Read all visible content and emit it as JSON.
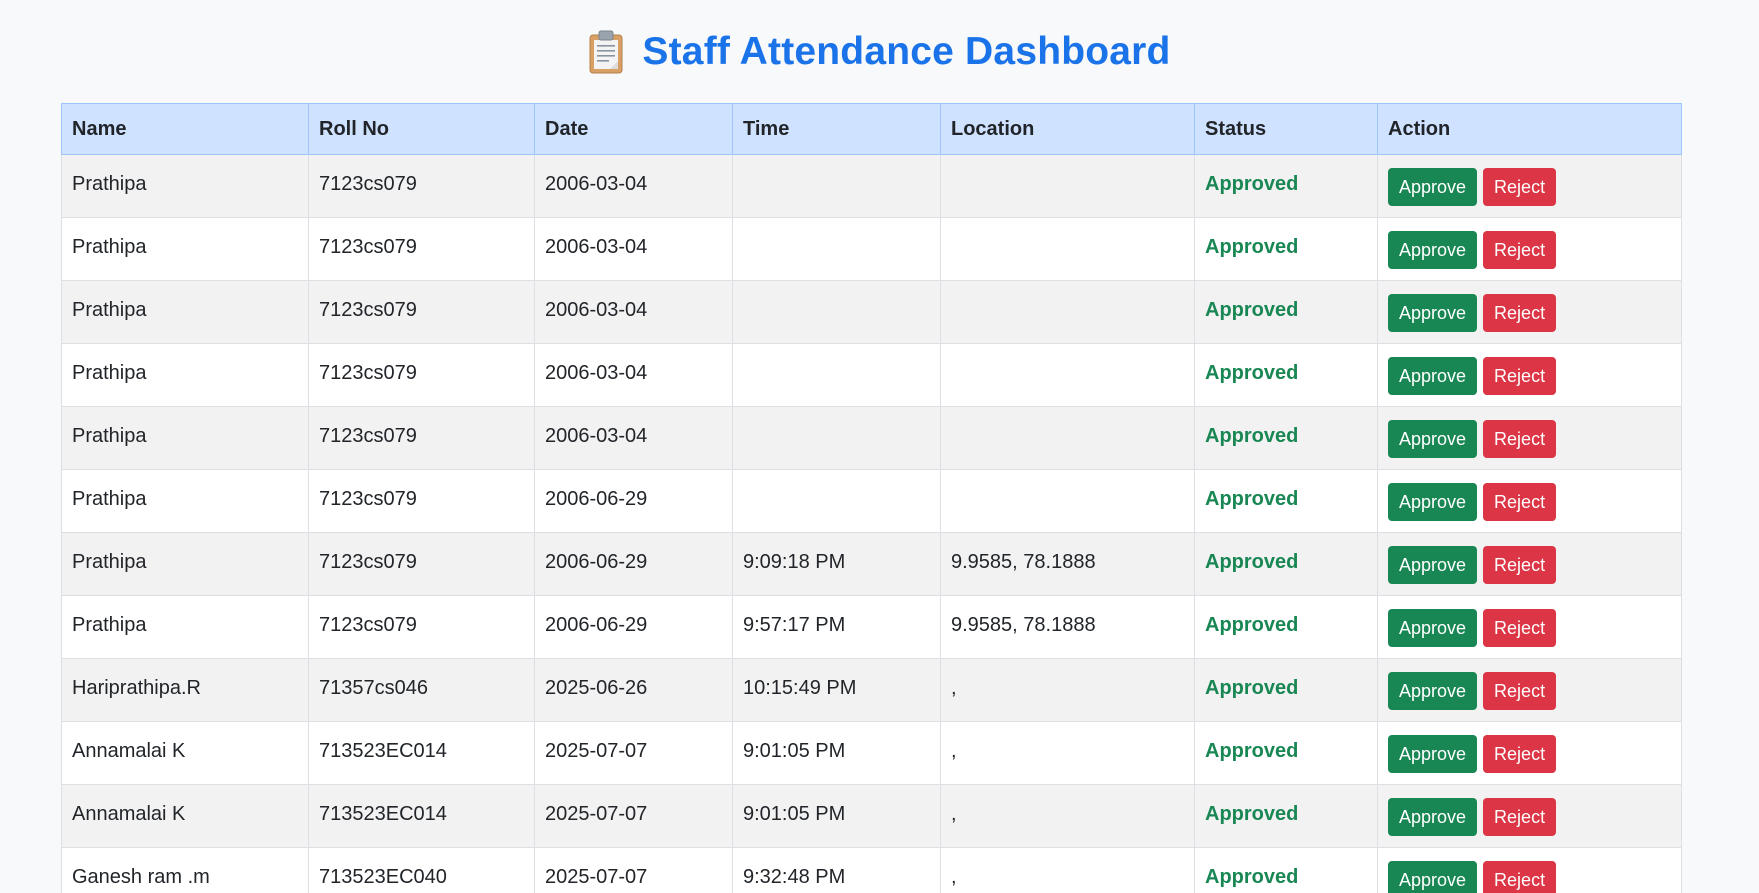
{
  "header": {
    "icon": "clipboard-icon",
    "title": "Staff Attendance Dashboard",
    "title_color": "#1a73e8"
  },
  "table": {
    "columns": [
      "Name",
      "Roll No",
      "Date",
      "Time",
      "Location",
      "Status",
      "Action"
    ],
    "rows": [
      {
        "name": "Prathipa",
        "roll": "7123cs079",
        "date": "2006-03-04",
        "time": "",
        "location": "",
        "status": "Approved"
      },
      {
        "name": "Prathipa",
        "roll": "7123cs079",
        "date": "2006-03-04",
        "time": "",
        "location": "",
        "status": "Approved"
      },
      {
        "name": "Prathipa",
        "roll": "7123cs079",
        "date": "2006-03-04",
        "time": "",
        "location": "",
        "status": "Approved"
      },
      {
        "name": "Prathipa",
        "roll": "7123cs079",
        "date": "2006-03-04",
        "time": "",
        "location": "",
        "status": "Approved"
      },
      {
        "name": "Prathipa",
        "roll": "7123cs079",
        "date": "2006-03-04",
        "time": "",
        "location": "",
        "status": "Approved"
      },
      {
        "name": "Prathipa",
        "roll": "7123cs079",
        "date": "2006-06-29",
        "time": "",
        "location": "",
        "status": "Approved"
      },
      {
        "name": "Prathipa",
        "roll": "7123cs079",
        "date": "2006-06-29",
        "time": "9:09:18 PM",
        "location": "9.9585, 78.1888",
        "status": "Approved"
      },
      {
        "name": "Prathipa",
        "roll": "7123cs079",
        "date": "2006-06-29",
        "time": "9:57:17 PM",
        "location": "9.9585, 78.1888",
        "status": "Approved"
      },
      {
        "name": "Hariprathipa.R",
        "roll": "71357cs046",
        "date": "2025-06-26",
        "time": "10:15:49 PM",
        "location": ",",
        "status": "Approved"
      },
      {
        "name": "Annamalai K",
        "roll": "713523EC014",
        "date": "2025-07-07",
        "time": "9:01:05 PM",
        "location": ",",
        "status": "Approved"
      },
      {
        "name": "Annamalai K",
        "roll": "713523EC014",
        "date": "2025-07-07",
        "time": "9:01:05 PM",
        "location": ",",
        "status": "Approved"
      },
      {
        "name": "Ganesh ram .m",
        "roll": "713523EC040",
        "date": "2025-07-07",
        "time": "9:32:48 PM",
        "location": ",",
        "status": "Approved"
      }
    ],
    "approve_label": "Approve",
    "reject_label": "Reject"
  },
  "colors": {
    "header_bg": "#cfe2ff",
    "approved": "#198754",
    "approve_button": "#198754",
    "reject_button": "#dc3545"
  }
}
